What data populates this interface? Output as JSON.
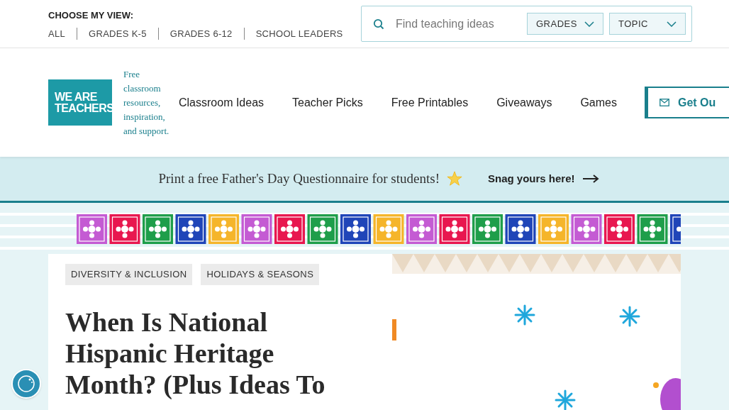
{
  "view_chooser": {
    "label": "CHOOSE MY VIEW:",
    "options": [
      {
        "label": "ALL",
        "selected": false
      },
      {
        "label": "GRADES K-5",
        "selected": false
      },
      {
        "label": "GRADES 6-12",
        "selected": false
      },
      {
        "label": "SCHOOL LEADERS",
        "selected": false
      }
    ]
  },
  "search": {
    "placeholder": "Find teaching ideas",
    "filters": [
      "GRADES",
      "TOPIC"
    ]
  },
  "logo": {
    "line_1": "WE ARE",
    "line_2": "TEACHERS"
  },
  "tagline": "Free classroom resources, inspiration, and support.",
  "nav": [
    "Classroom Ideas",
    "Teacher Picks",
    "Free Printables",
    "Giveaways",
    "Games"
  ],
  "cta": "Get Ou",
  "promo": {
    "text": "Print a free Father's Day Questionnaire for students!",
    "link": "Snag yours here!"
  },
  "article": {
    "tags": [
      "DIVERSITY & INCLUSION",
      "HOLIDAYS & SEASONS"
    ],
    "title": "When Is National Hispanic Heritage Month? (Plus Ideas To"
  }
}
